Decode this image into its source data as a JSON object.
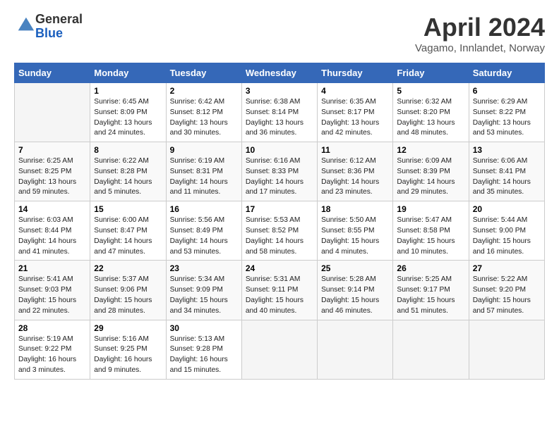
{
  "header": {
    "logo_general": "General",
    "logo_blue": "Blue",
    "month": "April 2024",
    "location": "Vagamo, Innlandet, Norway"
  },
  "weekdays": [
    "Sunday",
    "Monday",
    "Tuesday",
    "Wednesday",
    "Thursday",
    "Friday",
    "Saturday"
  ],
  "weeks": [
    [
      {
        "num": "",
        "info": ""
      },
      {
        "num": "1",
        "info": "Sunrise: 6:45 AM\nSunset: 8:09 PM\nDaylight: 13 hours\nand 24 minutes."
      },
      {
        "num": "2",
        "info": "Sunrise: 6:42 AM\nSunset: 8:12 PM\nDaylight: 13 hours\nand 30 minutes."
      },
      {
        "num": "3",
        "info": "Sunrise: 6:38 AM\nSunset: 8:14 PM\nDaylight: 13 hours\nand 36 minutes."
      },
      {
        "num": "4",
        "info": "Sunrise: 6:35 AM\nSunset: 8:17 PM\nDaylight: 13 hours\nand 42 minutes."
      },
      {
        "num": "5",
        "info": "Sunrise: 6:32 AM\nSunset: 8:20 PM\nDaylight: 13 hours\nand 48 minutes."
      },
      {
        "num": "6",
        "info": "Sunrise: 6:29 AM\nSunset: 8:22 PM\nDaylight: 13 hours\nand 53 minutes."
      }
    ],
    [
      {
        "num": "7",
        "info": "Sunrise: 6:25 AM\nSunset: 8:25 PM\nDaylight: 13 hours\nand 59 minutes."
      },
      {
        "num": "8",
        "info": "Sunrise: 6:22 AM\nSunset: 8:28 PM\nDaylight: 14 hours\nand 5 minutes."
      },
      {
        "num": "9",
        "info": "Sunrise: 6:19 AM\nSunset: 8:31 PM\nDaylight: 14 hours\nand 11 minutes."
      },
      {
        "num": "10",
        "info": "Sunrise: 6:16 AM\nSunset: 8:33 PM\nDaylight: 14 hours\nand 17 minutes."
      },
      {
        "num": "11",
        "info": "Sunrise: 6:12 AM\nSunset: 8:36 PM\nDaylight: 14 hours\nand 23 minutes."
      },
      {
        "num": "12",
        "info": "Sunrise: 6:09 AM\nSunset: 8:39 PM\nDaylight: 14 hours\nand 29 minutes."
      },
      {
        "num": "13",
        "info": "Sunrise: 6:06 AM\nSunset: 8:41 PM\nDaylight: 14 hours\nand 35 minutes."
      }
    ],
    [
      {
        "num": "14",
        "info": "Sunrise: 6:03 AM\nSunset: 8:44 PM\nDaylight: 14 hours\nand 41 minutes."
      },
      {
        "num": "15",
        "info": "Sunrise: 6:00 AM\nSunset: 8:47 PM\nDaylight: 14 hours\nand 47 minutes."
      },
      {
        "num": "16",
        "info": "Sunrise: 5:56 AM\nSunset: 8:49 PM\nDaylight: 14 hours\nand 53 minutes."
      },
      {
        "num": "17",
        "info": "Sunrise: 5:53 AM\nSunset: 8:52 PM\nDaylight: 14 hours\nand 58 minutes."
      },
      {
        "num": "18",
        "info": "Sunrise: 5:50 AM\nSunset: 8:55 PM\nDaylight: 15 hours\nand 4 minutes."
      },
      {
        "num": "19",
        "info": "Sunrise: 5:47 AM\nSunset: 8:58 PM\nDaylight: 15 hours\nand 10 minutes."
      },
      {
        "num": "20",
        "info": "Sunrise: 5:44 AM\nSunset: 9:00 PM\nDaylight: 15 hours\nand 16 minutes."
      }
    ],
    [
      {
        "num": "21",
        "info": "Sunrise: 5:41 AM\nSunset: 9:03 PM\nDaylight: 15 hours\nand 22 minutes."
      },
      {
        "num": "22",
        "info": "Sunrise: 5:37 AM\nSunset: 9:06 PM\nDaylight: 15 hours\nand 28 minutes."
      },
      {
        "num": "23",
        "info": "Sunrise: 5:34 AM\nSunset: 9:09 PM\nDaylight: 15 hours\nand 34 minutes."
      },
      {
        "num": "24",
        "info": "Sunrise: 5:31 AM\nSunset: 9:11 PM\nDaylight: 15 hours\nand 40 minutes."
      },
      {
        "num": "25",
        "info": "Sunrise: 5:28 AM\nSunset: 9:14 PM\nDaylight: 15 hours\nand 46 minutes."
      },
      {
        "num": "26",
        "info": "Sunrise: 5:25 AM\nSunset: 9:17 PM\nDaylight: 15 hours\nand 51 minutes."
      },
      {
        "num": "27",
        "info": "Sunrise: 5:22 AM\nSunset: 9:20 PM\nDaylight: 15 hours\nand 57 minutes."
      }
    ],
    [
      {
        "num": "28",
        "info": "Sunrise: 5:19 AM\nSunset: 9:22 PM\nDaylight: 16 hours\nand 3 minutes."
      },
      {
        "num": "29",
        "info": "Sunrise: 5:16 AM\nSunset: 9:25 PM\nDaylight: 16 hours\nand 9 minutes."
      },
      {
        "num": "30",
        "info": "Sunrise: 5:13 AM\nSunset: 9:28 PM\nDaylight: 16 hours\nand 15 minutes."
      },
      {
        "num": "",
        "info": ""
      },
      {
        "num": "",
        "info": ""
      },
      {
        "num": "",
        "info": ""
      },
      {
        "num": "",
        "info": ""
      }
    ]
  ]
}
